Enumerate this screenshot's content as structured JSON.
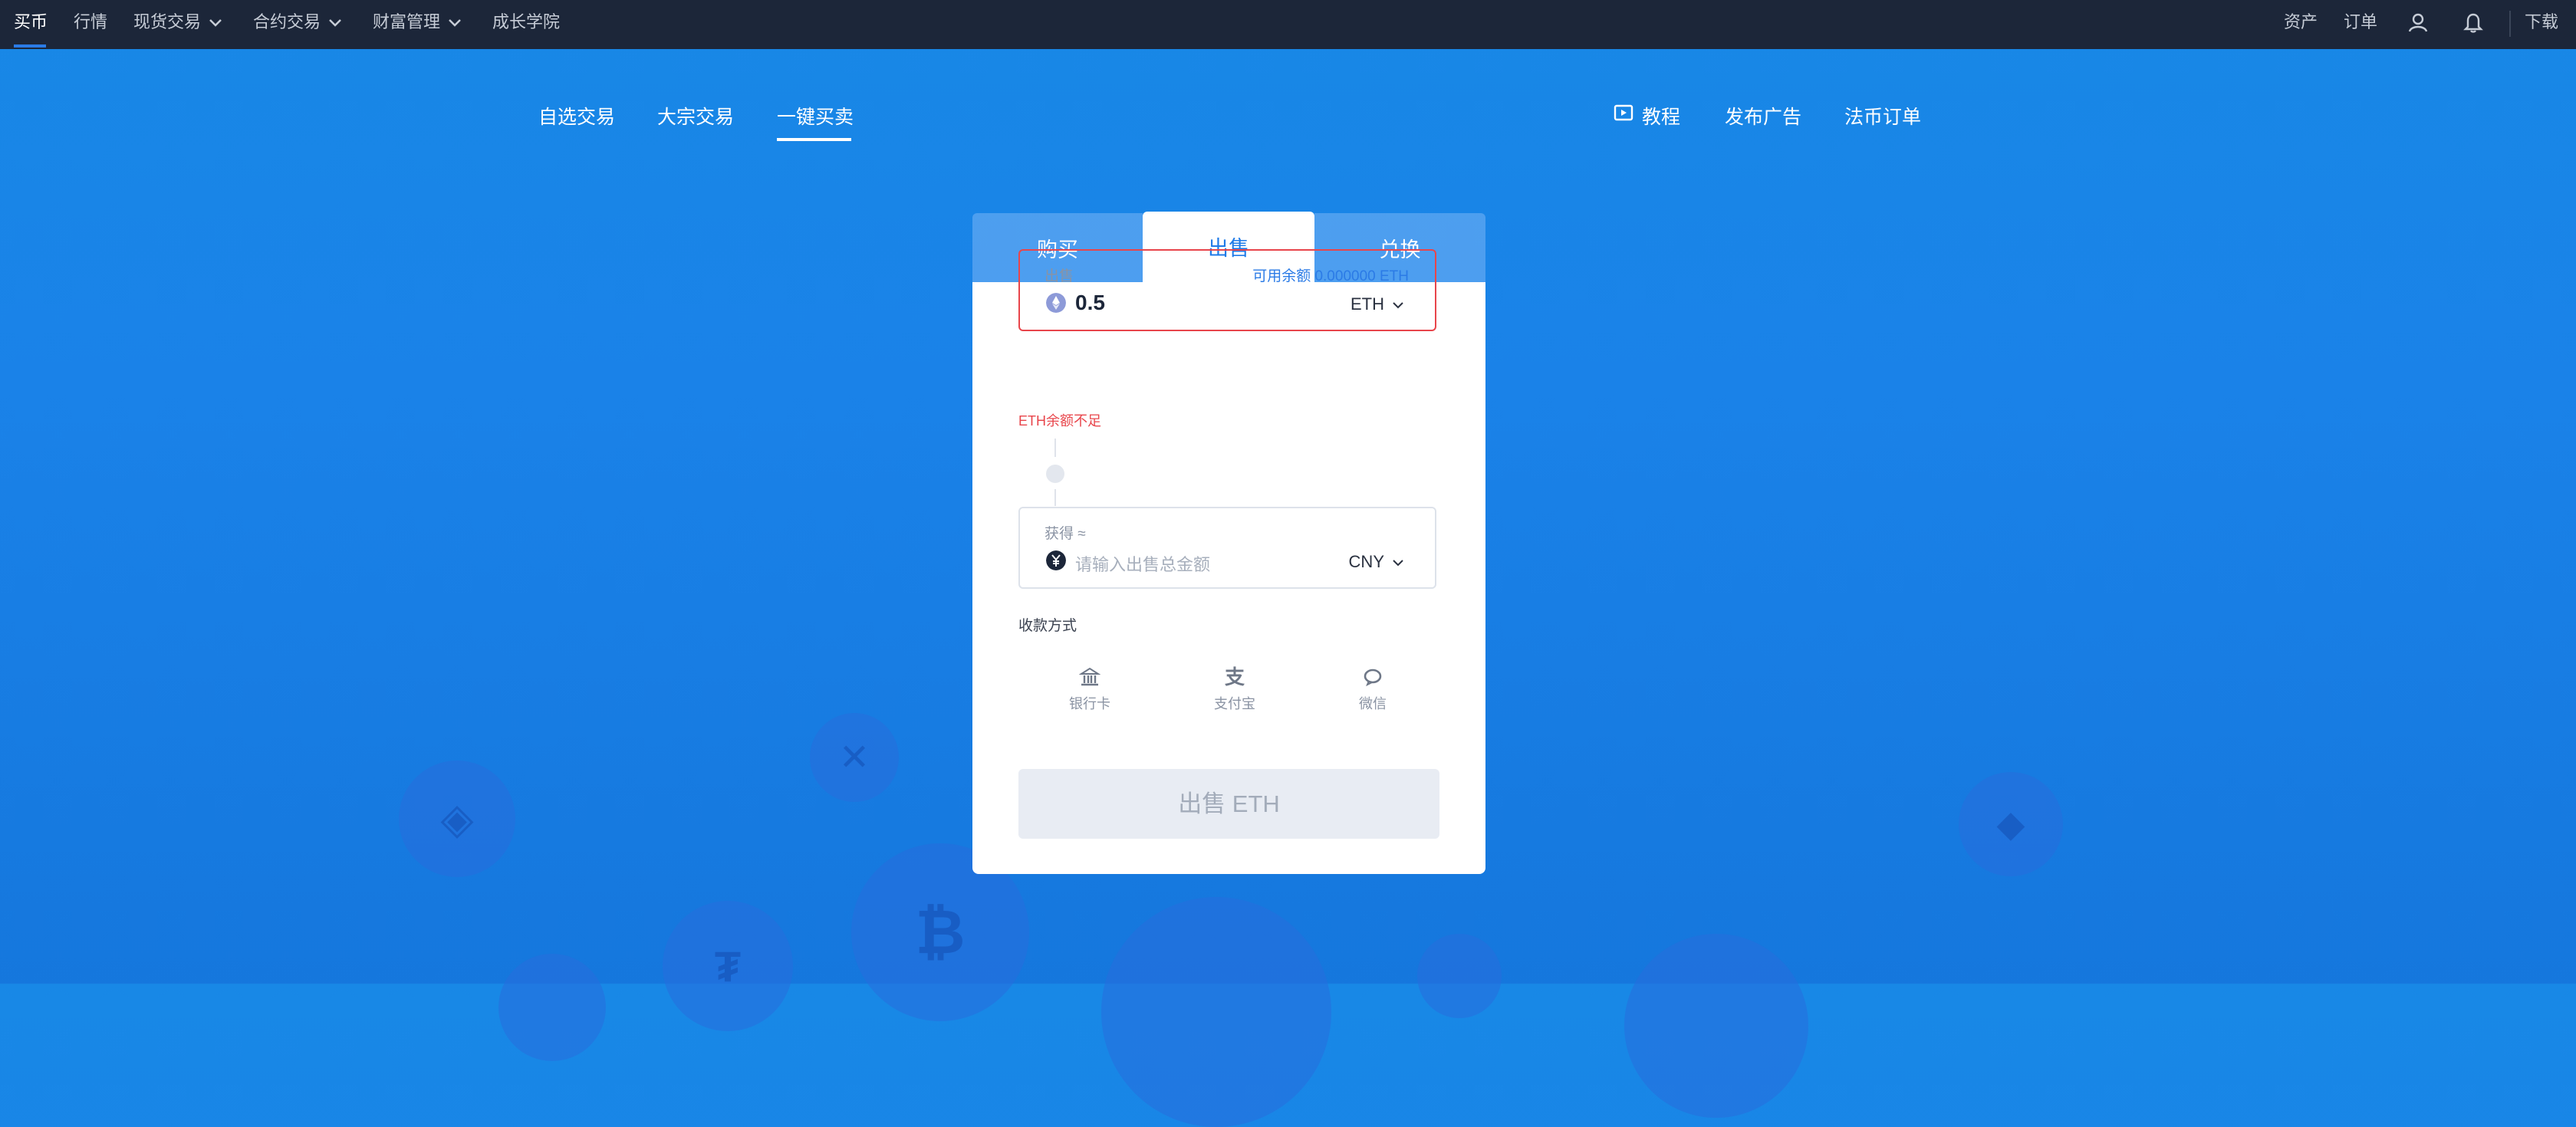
{
  "topnav": {
    "items": [
      {
        "label": "买币",
        "active": true
      },
      {
        "label": "行情"
      },
      {
        "label": "现货交易",
        "dropdown": true
      },
      {
        "label": "合约交易",
        "dropdown": true
      },
      {
        "label": "财富管理",
        "dropdown": true
      },
      {
        "label": "成长学院"
      }
    ],
    "right": {
      "assets": "资产",
      "orders": "订单",
      "download": "下载"
    },
    "icons": [
      "user-icon",
      "bell-icon"
    ]
  },
  "subnav": {
    "left": [
      "自选交易",
      "大宗交易",
      "一键买卖"
    ],
    "active": "一键买卖",
    "right": {
      "tutorial": "教程",
      "post_ad": "发布广告",
      "fiat_orders": "法币订单"
    }
  },
  "tabs": [
    {
      "label": "购买"
    },
    {
      "label": "出售",
      "active": true
    },
    {
      "label": "兑换"
    }
  ],
  "sell_field": {
    "label": "出售",
    "available": "可用余额 0.000000 ETH",
    "value": "0.5",
    "currency": "ETH",
    "icon": "eth-icon"
  },
  "error": "ETH余额不足",
  "get_field": {
    "label": "获得 ≈",
    "placeholder": "请输入出售总金额",
    "currency": "CNY",
    "icon": "yuan-icon"
  },
  "payment": {
    "title": "收款方式",
    "methods": [
      {
        "label": "银行卡",
        "icon": "bank-icon"
      },
      {
        "label": "支付宝",
        "icon": "alipay-icon"
      },
      {
        "label": "微信",
        "icon": "wechat-icon"
      }
    ]
  },
  "submit": {
    "label": "出售 ETH"
  },
  "colors": {
    "nav_bg": "#1c2639",
    "accent": "#2b7be6",
    "error": "#e8454b",
    "bg": "#1a82e8"
  }
}
